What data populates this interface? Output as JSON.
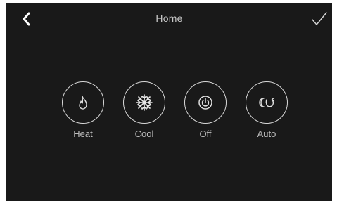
{
  "header": {
    "title": "Home",
    "back_icon": "chevron-left-icon",
    "confirm_icon": "checkmark-icon"
  },
  "modes": [
    {
      "label": "Heat",
      "icon": "flame-icon"
    },
    {
      "label": "Cool",
      "icon": "snowflake-icon"
    },
    {
      "label": "Off",
      "icon": "power-icon"
    },
    {
      "label": "Auto",
      "icon": "auto-cycle-icon"
    }
  ],
  "colors": {
    "background": "#191919",
    "foreground": "#d8d8d8"
  }
}
